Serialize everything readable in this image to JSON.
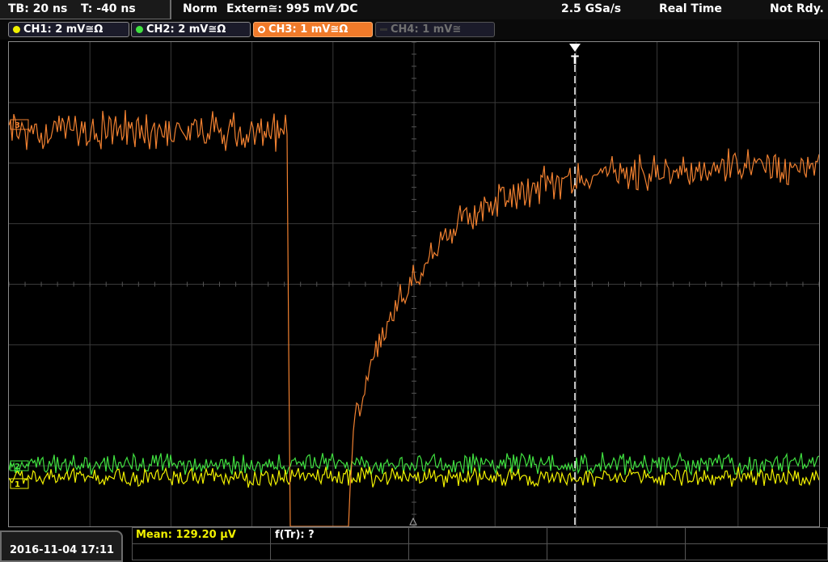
{
  "status": {
    "timebase": "TB: 20 ns",
    "trigger_time": "T: -40 ns",
    "mode": "Norm",
    "trigger_source": "Extern≅: 995 mV ⁄DC",
    "sample_rate": "2.5 GSa/s",
    "acq_mode": "Real Time",
    "state": "Not Rdy."
  },
  "channels": [
    {
      "label": "CH1: 2 mV≅Ω",
      "color": "#f0f000",
      "active": true
    },
    {
      "label": "CH2: 2 mV≅Ω",
      "color": "#40e040",
      "active": true
    },
    {
      "label": "CH3: 1 mV≅Ω",
      "color": "#f08030",
      "active": true,
      "selected": true
    },
    {
      "label": "CH4: 1 mV≅",
      "color": "#707070",
      "active": false
    }
  ],
  "markers": {
    "trigger": "T",
    "ch1": "1",
    "ch2": "2",
    "ch3": "3"
  },
  "footer": {
    "datetime": "2016-11-04 17:11",
    "mean": "Mean: 129.20 µV",
    "rise": "f(Tr): ?"
  },
  "colors": {
    "ch1": "#f0f000",
    "ch2": "#40e040",
    "ch3": "#f08030",
    "grid": "#3a3a3a"
  }
}
